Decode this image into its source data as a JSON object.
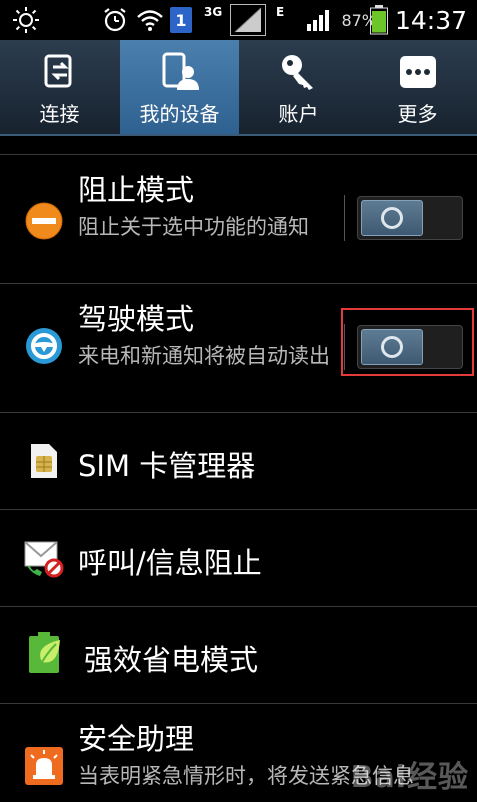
{
  "status_bar": {
    "network_3g": "3G",
    "network_e": "E",
    "battery": "87%",
    "time": "14:37",
    "badge_number": "1"
  },
  "tabs": [
    {
      "label": "连接",
      "icon": "connect-icon",
      "active": false
    },
    {
      "label": "我的设备",
      "icon": "my-device-icon",
      "active": true
    },
    {
      "label": "账户",
      "icon": "account-key-icon",
      "active": false
    },
    {
      "label": "更多",
      "icon": "more-icon",
      "active": false
    }
  ],
  "list": {
    "block_mode": {
      "title": "阻止模式",
      "subtitle": "阻止关于选中功能的通知",
      "toggle_on": false
    },
    "driving_mode": {
      "title": "驾驶模式",
      "subtitle": "来电和新通知将被自动读出",
      "toggle_on": false
    },
    "sim_manager": {
      "title": "SIM 卡管理器"
    },
    "call_block": {
      "title": "呼叫/信息阻止"
    },
    "power_saving": {
      "title": "强效省电模式"
    },
    "safety_assist": {
      "title": "安全助理",
      "subtitle": "当表明紧急情形时，将发送紧急信息"
    }
  },
  "colors": {
    "accent": "#2f6190",
    "highlight": "#e53a3a"
  },
  "watermark": "Bai经验"
}
